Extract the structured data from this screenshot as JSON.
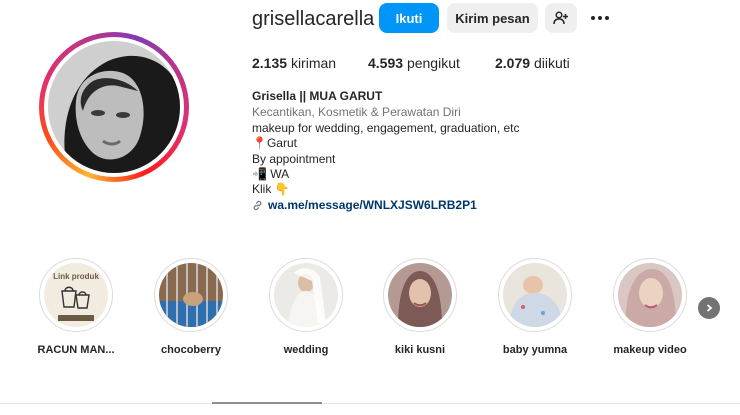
{
  "profile": {
    "username": "grisellacarella",
    "follow_label": "Ikuti",
    "message_label": "Kirim pesan"
  },
  "stats": [
    {
      "value": "2.135",
      "label": "kiriman"
    },
    {
      "value": "4.593",
      "label": "pengikut"
    },
    {
      "value": "2.079",
      "label": "diikuti"
    }
  ],
  "bio": {
    "name": "Grisella || MUA GARUT",
    "category": "Kecantikan, Kosmetik & Perawatan Diri",
    "line1": "makeup for wedding, engagement, graduation, etc",
    "line2": "📍Garut",
    "line3": "By appointment",
    "line4": "📲 WA",
    "line5": "Klik 👇",
    "link": "wa.me/message/WNLXJSW6LRB2P1"
  },
  "highlights": [
    {
      "label": "RACUN MAN...",
      "cover_text": "Link produk"
    },
    {
      "label": "chocoberry"
    },
    {
      "label": "wedding"
    },
    {
      "label": "kiki kusni"
    },
    {
      "label": "baby yumna"
    },
    {
      "label": "makeup video"
    }
  ],
  "icons": {
    "add_user": "person-plus-icon",
    "more": "more-options-icon",
    "link": "link-icon",
    "next": "chevron-right-icon"
  },
  "colors": {
    "follow_button": "#0095f6",
    "link_text": "#00376b",
    "secondary_button": "#efefef"
  }
}
